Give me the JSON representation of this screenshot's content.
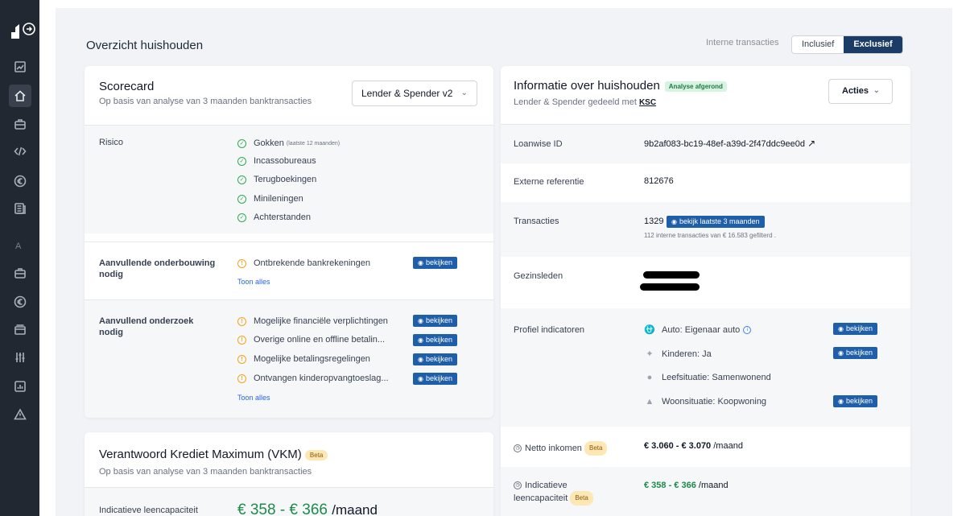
{
  "sidebar": {
    "icons": [
      "logo-icon",
      "chart-icon",
      "home-icon",
      "briefcase-icon",
      "code-icon",
      "euro-icon",
      "document-icon",
      "briefcase-icon",
      "euro-icon",
      "card-icon",
      "sliders-icon",
      "report-icon",
      "warning-icon"
    ],
    "section_letter": "A"
  },
  "header": {
    "title": "Overzicht huishouden",
    "toggle_label": "Interne transacties",
    "toggle_inclusive": "Inclusief",
    "toggle_exclusive": "Exclusief",
    "toggle_selected": "Exclusief"
  },
  "scorecard": {
    "title": "Scorecard",
    "subtitle": "Op basis van analyse van 3 maanden banktransacties",
    "model_select": "Lender & Spender v2",
    "risk": {
      "label": "Risico",
      "items": [
        {
          "label": "Gokken",
          "note": "(laatste 12 maanden)"
        },
        {
          "label": "Incassobureaus"
        },
        {
          "label": "Terugboekingen"
        },
        {
          "label": "Minileningen"
        },
        {
          "label": "Achterstanden"
        }
      ]
    },
    "extra_basis": {
      "label": "Aanvullende onderbouwing nodig",
      "items": [
        {
          "label": "Ontbrekende bankrekeningen",
          "button": "bekijken"
        }
      ],
      "show_all": "Toon alles"
    },
    "extra_research": {
      "label": "Aanvullend onderzoek nodig",
      "items": [
        {
          "label": "Mogelijke financiële verplichtingen",
          "button": "bekijken"
        },
        {
          "label": "Overige online en offline betalin...",
          "button": "bekijken"
        },
        {
          "label": "Mogelijke betalingsregelingen",
          "button": "bekijken"
        },
        {
          "label": "Ontvangen kinderopvangtoeslag...",
          "button": "bekijken"
        }
      ],
      "show_all": "Toon alles"
    }
  },
  "vkm": {
    "title": "Verantwoord Krediet Maximum (VKM)",
    "badge": "Beta",
    "subtitle": "Op basis van analyse van 3 maanden banktransacties",
    "capacity_label": "Indicatieve leencapaciteit",
    "capacity_value": "€ 358 - € 366",
    "capacity_unit": "/maand"
  },
  "info": {
    "title": "Informatie over huishouden",
    "status_badge": "Analyse afgerond",
    "shared_with": "Lender & Spender gedeeld met",
    "partner_logo": "KSC",
    "actions_label": "Acties",
    "loanwise_id_label": "Loanwise ID",
    "loanwise_id": "9b2af083-bc19-48ef-a39d-2f47ddc9ee0d",
    "ext_ref_label": "Externe referentie",
    "ext_ref": "812676",
    "transactions_label": "Transacties",
    "transactions_count": "1329",
    "transactions_button": "bekijk laatste 3 maanden",
    "transactions_note": "112 interne transacties van € 16.583 gefilterd .",
    "members_label": "Gezinsleden",
    "profile_label": "Profiel indicatoren",
    "profile_items": [
      {
        "label": "Auto: Eigenaar auto",
        "icon": "car-icon",
        "button": "bekijken"
      },
      {
        "label": "Kinderen: Ja",
        "icon": "children-icon",
        "button": "bekijken"
      },
      {
        "label": "Leefsituatie: Samenwonend",
        "icon": "people-icon",
        "button": ""
      },
      {
        "label": "Woonsituatie: Koopwoning",
        "icon": "house-icon",
        "button": "bekijken"
      }
    ],
    "net_income_label": "Netto inkomen",
    "net_income_badge": "Beta",
    "net_income_value": "€ 3.060 - € 3.070",
    "net_income_unit": "/maand",
    "capacity_label_1": "Indicatieve",
    "capacity_label_2": "leencapaciteit",
    "capacity_badge": "Beta",
    "capacity_value": "€ 358 - € 366",
    "capacity_unit": "/maand"
  },
  "colors": {
    "sidebar": "#222831",
    "accent": "#1b3c66",
    "button": "#1f5faa",
    "success": "#34a853",
    "warning": "#f4a51c"
  }
}
